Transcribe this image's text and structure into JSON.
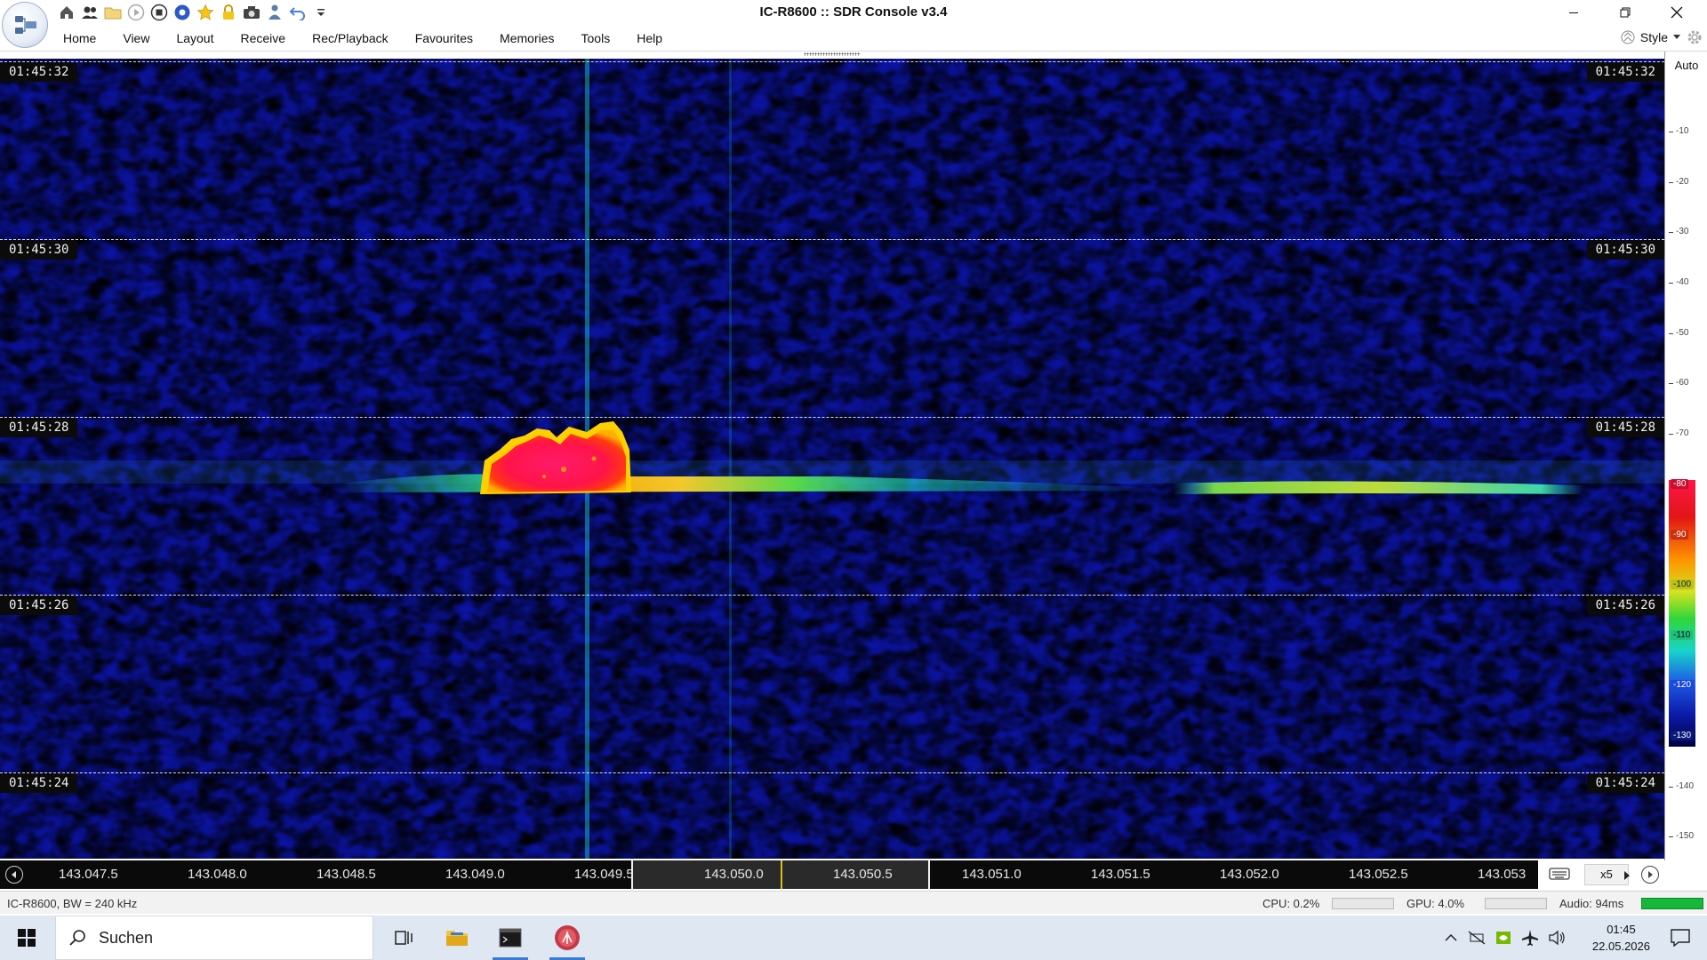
{
  "window": {
    "title": "IC-R8600 :: SDR Console v3.4"
  },
  "menu": {
    "items": [
      "Home",
      "View",
      "Layout",
      "Receive",
      "Rec/Playback",
      "Favourites",
      "Memories",
      "Tools",
      "Help"
    ],
    "style_label": "Style"
  },
  "waterfall": {
    "timestamps": [
      "01:45:32",
      "01:45:30",
      "01:45:28",
      "01:45:26",
      "01:45:24"
    ]
  },
  "scale": {
    "mode": "Auto",
    "ticks": [
      "-10",
      "-20",
      "-30",
      "-40",
      "-50",
      "-60",
      "-70",
      "-80",
      "-90",
      "-100",
      "-110",
      "-120",
      "-130",
      "-140",
      "-150"
    ]
  },
  "frequency_axis": {
    "labels": [
      "143.047.5",
      "143.048.0",
      "143.048.5",
      "143.049.0",
      "143.049.5",
      "143.050.0",
      "143.050.5",
      "143.051.0",
      "143.051.5",
      "143.052.0",
      "143.052.5",
      "143.053"
    ],
    "zoom": "x5"
  },
  "status": {
    "device": "IC-R8600, BW = 240 kHz",
    "cpu": "CPU: 0.2%",
    "gpu": "GPU: 4.0%",
    "audio": "Audio: 94ms",
    "audio_level": 1.0
  },
  "taskbar": {
    "search_placeholder": "Suchen",
    "time": "01:45",
    "date": "22.05.2026"
  },
  "colors": {
    "waterfall_bg": "#0a0e7a",
    "signal_hot": "#ff1448",
    "passband_marker": "#d8c21a",
    "accent": "#3a7bd5"
  }
}
